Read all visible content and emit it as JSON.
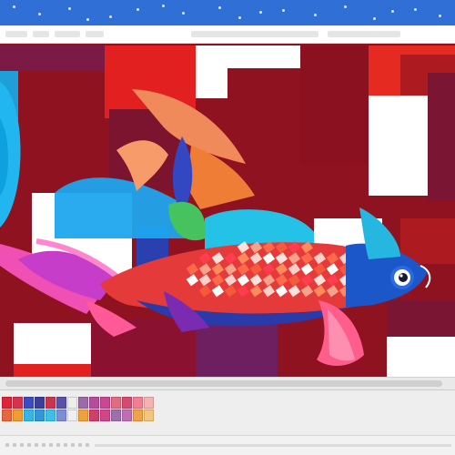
{
  "window": {
    "titlebar_color": "#2f6fd6"
  },
  "canvas": {
    "artwork": "geometric-koi-fish-illustration",
    "background_color": "#8f1220"
  },
  "palette": {
    "swatches": [
      "#e0213a",
      "#d6324e",
      "#3a4cc0",
      "#3c3f9a",
      "#c9354c",
      "#5a51a8",
      "#eeeeee",
      "#9c6aa8",
      "#b54d9a",
      "#c94891",
      "#e16b7f",
      "#d44a71",
      "#f07e94",
      "#f6b1b1",
      "#e9663c",
      "#f29b31",
      "#35b6e8",
      "#2f98d8",
      "#3cc0e6",
      "#7f8cd9",
      "#efefef",
      "#f0a13a",
      "#cf3f6b",
      "#d24586",
      "#9c6fae",
      "#bc6fb5",
      "#f0a246",
      "#f4c57a"
    ]
  }
}
